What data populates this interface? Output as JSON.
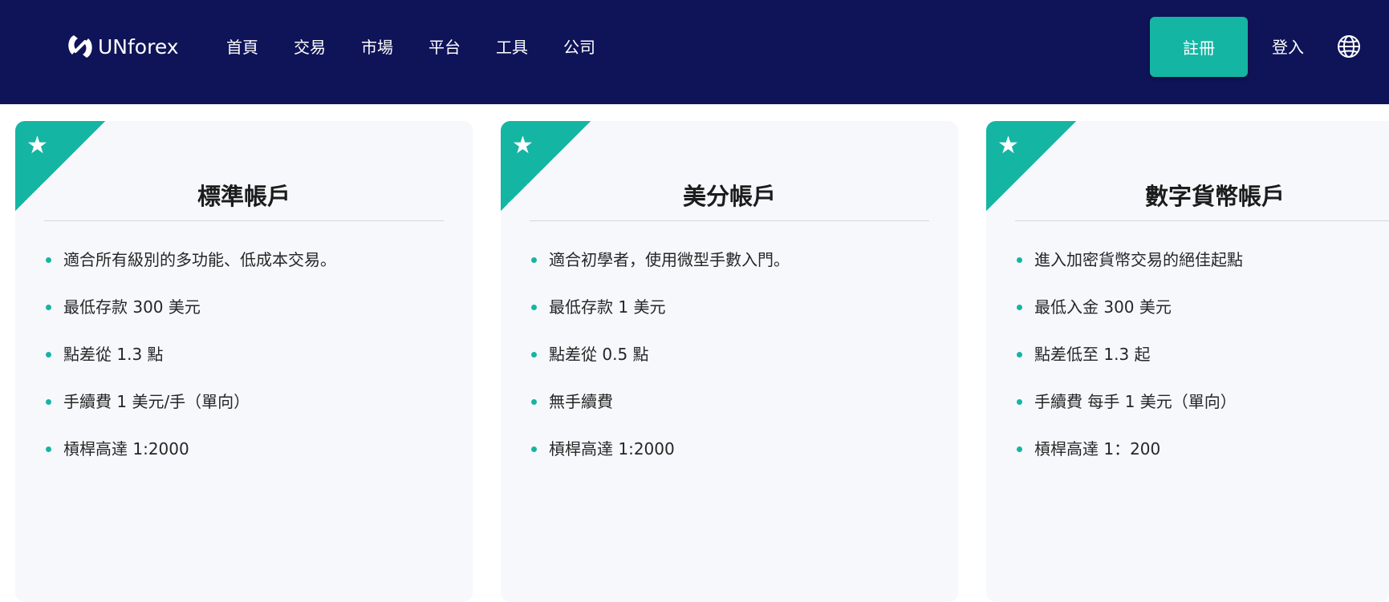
{
  "brand": {
    "name": "UNforex"
  },
  "nav": {
    "items": [
      "首頁",
      "交易",
      "市場",
      "平台",
      "工具",
      "公司"
    ],
    "register_label": "註冊",
    "login_label": "登入",
    "globe_icon": "globe-icon"
  },
  "colors": {
    "nav_bg": "#0f1458",
    "accent": "#15b5a3",
    "card_bg": "#f6f8fc"
  },
  "cards": [
    {
      "title": "標準帳戶",
      "features": [
        "適合所有級別的多功能、低成本交易。",
        "最低存款 300 美元",
        "點差從 1.3 點",
        "手續費 1 美元/手（單向）",
        "槓桿高達 1:2000"
      ]
    },
    {
      "title": "美分帳戶",
      "features": [
        "適合初學者，使用微型手數入門。",
        "最低存款 1 美元",
        "點差從 0.5 點",
        "無手續費",
        "槓桿高達 1:2000"
      ]
    },
    {
      "title": "數字貨幣帳戶",
      "features": [
        "進入加密貨幣交易的絕佳起點",
        "最低入金 300 美元",
        "點差低至 1.3 起",
        "手續費 每手 1 美元（單向）",
        "槓桿高達 1：200"
      ]
    }
  ]
}
